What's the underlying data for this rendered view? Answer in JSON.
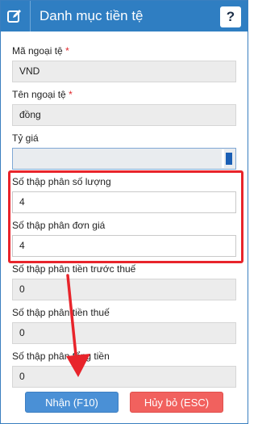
{
  "dialog": {
    "title": "Danh mục tiền tệ",
    "help_label": "?",
    "title_icon": "edit-icon"
  },
  "fields": [
    {
      "label": "Mã ngoại tệ",
      "required": "*",
      "value": "VND"
    },
    {
      "label": "Tên ngoại tệ",
      "required": "*",
      "value": "đồng"
    },
    {
      "label": "Tỷ giá",
      "value": ""
    },
    {
      "label": "Số thập phân số lượng",
      "value": "4"
    },
    {
      "label": "Số thập phân đơn giá",
      "value": "4"
    },
    {
      "label": "Số thập phân tiền trước thuế",
      "value": "0"
    },
    {
      "label": "Số thập phân tiền thuế",
      "value": "0"
    },
    {
      "label": "Số thập phân tổng tiền",
      "value": "0"
    }
  ],
  "buttons": {
    "ok_label": "Nhận (F10)",
    "cancel_label": "Hủy bỏ (ESC)"
  },
  "colors": {
    "titlebar": "#2f7ec2",
    "ok_button": "#4a90d6",
    "cancel_button": "#f1615e",
    "highlight": "#e8242b",
    "required_mark": "#e0262a"
  }
}
